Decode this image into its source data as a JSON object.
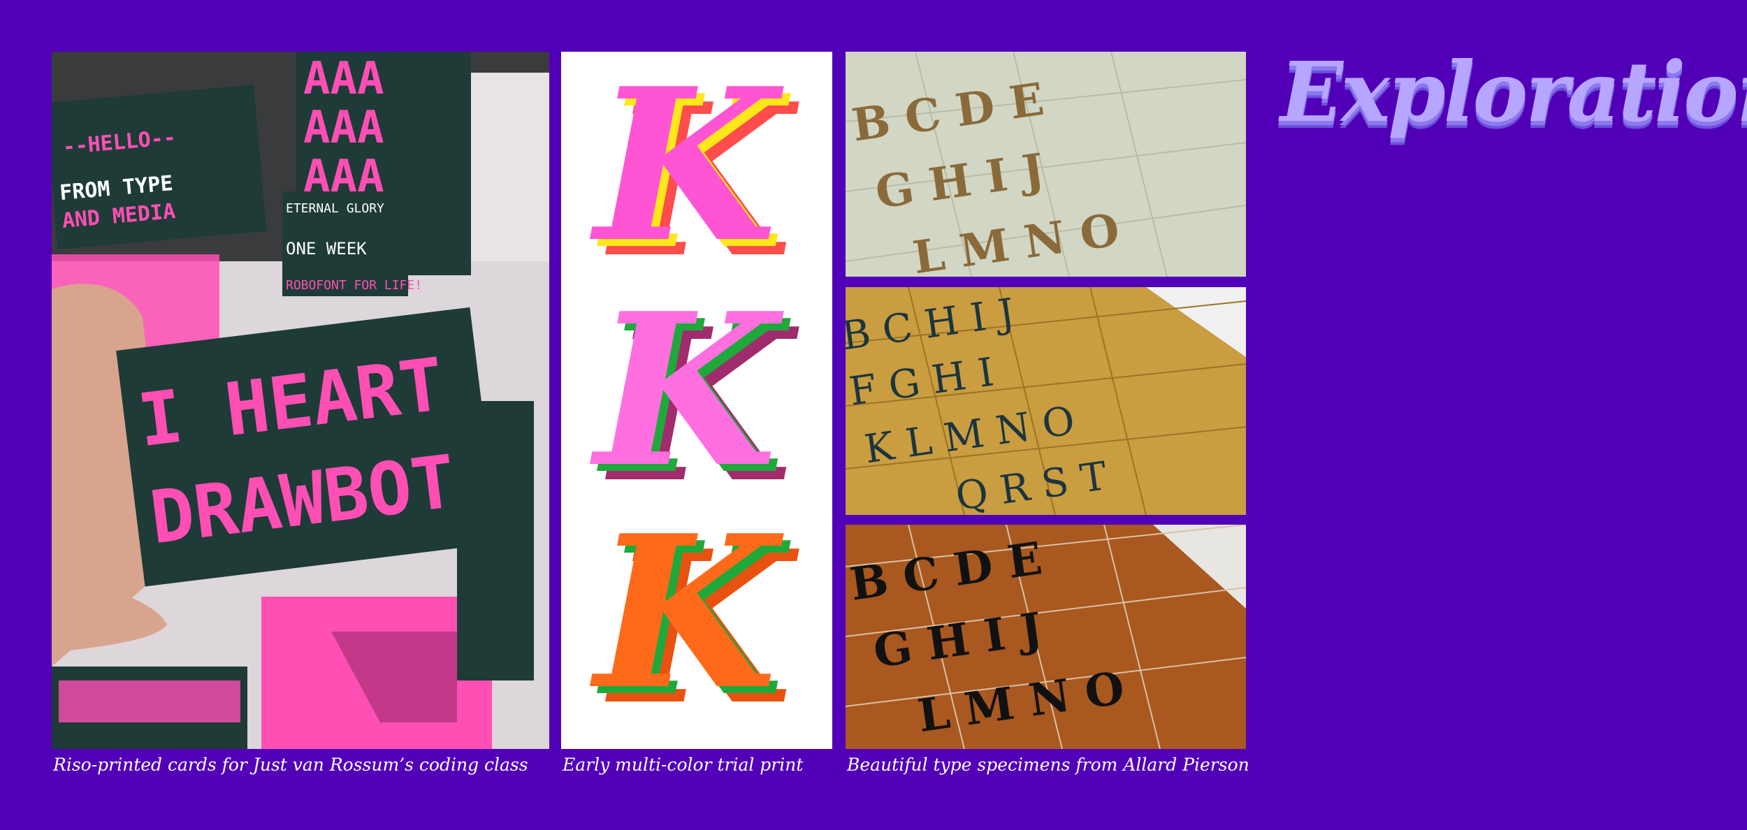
{
  "title": "Exploration",
  "captions": {
    "riso": "Riso-printed cards for Just van Rossum’s coding class",
    "trial": "Early multi-color trial print",
    "specimens": "Beautiful type specimens from Allard Pierson"
  },
  "riso_card_texts": {
    "hello": "--HELLO--",
    "from_line1": "FROM TYPE",
    "from_line2": "AND MEDIA",
    "aaa": "AAA",
    "eternal": "ETERNAL GLORY",
    "one_week": "ONE WEEK",
    "robofont": "ROBOFONT FOR LIFE!",
    "heart_line1": "I HEART",
    "heart_line2": "DRAWBOT"
  },
  "trial_letter": "K",
  "specimen_rows": {
    "spec1_row1": "B C D E",
    "spec1_row2": "G H I J",
    "spec1_row3": "L M N O",
    "spec2_row1": "B C H I J",
    "spec2_row2": "F G H I",
    "spec2_row3": "K L M N O",
    "spec2_row4": "Q R S T",
    "spec3_row1": "B C D E",
    "spec3_row2": "G H I J",
    "spec3_row3": "L M N O"
  },
  "colors": {
    "background": "#5200b8",
    "title": "#b7a6ff",
    "riso_pink": "#ff4fb4",
    "riso_dark": "#1e3b37"
  }
}
